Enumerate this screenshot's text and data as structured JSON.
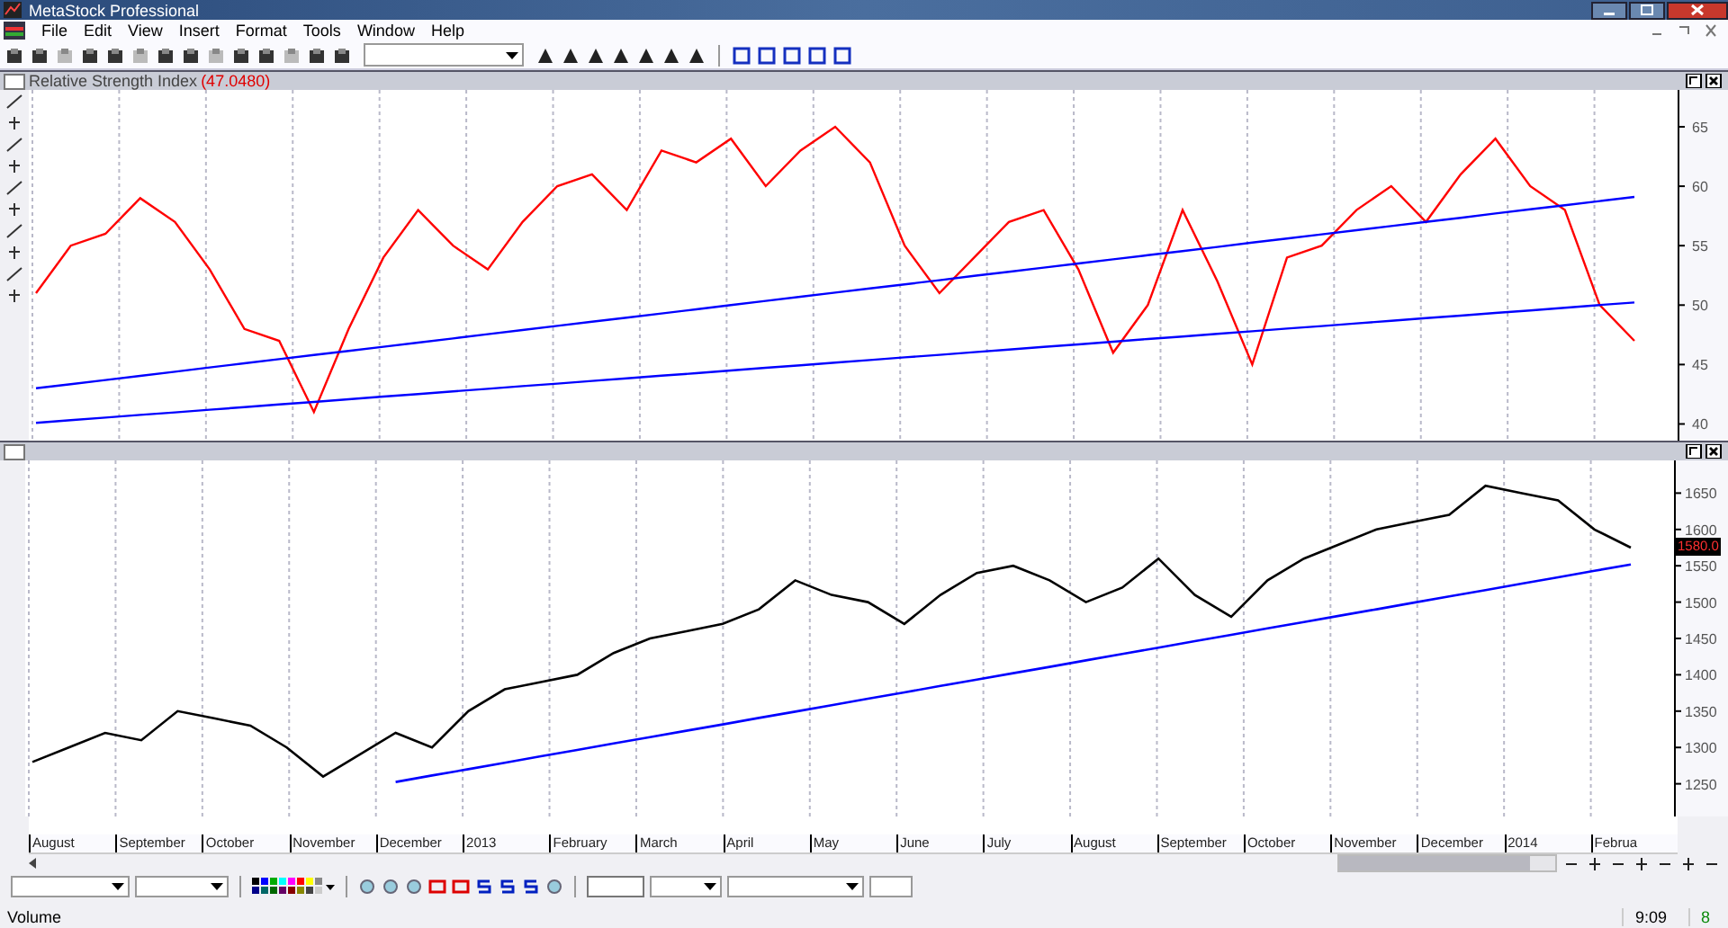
{
  "window": {
    "title": "MetaStock Professional"
  },
  "menu": [
    "File",
    "Edit",
    "View",
    "Insert",
    "Format",
    "Tools",
    "Window",
    "Help"
  ],
  "rsi_panel": {
    "checked": false,
    "value": "(47.0480)",
    "chart_data": {
      "type": "line",
      "grid": true,
      "categories": [
        null,
        null,
        null,
        null,
        null,
        null,
        null,
        null,
        null,
        null,
        null,
        null,
        null,
        null,
        null,
        null,
        null,
        null,
        null,
        null,
        null,
        null,
        null,
        null,
        null,
        null,
        null,
        null,
        null,
        null,
        null,
        null,
        null,
        null,
        null,
        null,
        null,
        null,
        null,
        null,
        null,
        null,
        null,
        null,
        null,
        null,
        null
      ],
      "series": [
        {
          "name": "Relative Strength Index",
          "color": "#ff0000",
          "values": [
            51,
            55,
            56,
            59,
            57,
            53,
            48,
            47,
            41,
            48,
            54,
            58,
            55,
            53,
            57,
            60,
            61,
            58,
            63,
            62,
            64,
            60,
            63,
            65,
            62,
            55,
            51,
            54,
            57,
            58,
            53,
            46,
            50,
            58,
            52,
            45,
            54,
            55,
            58,
            60,
            57,
            61,
            64,
            60,
            58,
            50,
            47
          ]
        },
        {
          "color": "#0000ff",
          "values": [
            43.0,
            43.35,
            43.7,
            44.05,
            44.4,
            44.75,
            45.1,
            45.45,
            45.8,
            46.15,
            46.5,
            46.85,
            47.2,
            47.55,
            47.9,
            48.25,
            48.6,
            48.95,
            49.3,
            49.65,
            50.0,
            50.35,
            50.7,
            51.05,
            51.4,
            51.75,
            52.1,
            52.45,
            52.8,
            53.15,
            53.5,
            53.85,
            54.2,
            54.55,
            54.9,
            55.25,
            55.6,
            55.95,
            56.3,
            56.65,
            57.0,
            57.35,
            57.7,
            58.05,
            58.4,
            58.75,
            59.1
          ]
        },
        {
          "color": "#0000ff",
          "values": [
            40.1,
            40.32,
            40.54,
            40.76,
            40.98,
            41.2,
            41.42,
            41.64,
            41.86,
            42.08,
            42.3,
            42.52,
            42.74,
            42.96,
            43.18,
            43.4,
            43.62,
            43.84,
            44.06,
            44.28,
            44.5,
            44.72,
            44.94,
            45.16,
            45.38,
            45.6,
            45.82,
            46.04,
            46.26,
            46.48,
            46.7,
            46.92,
            47.14,
            47.36,
            47.58,
            47.8,
            48.02,
            48.24,
            48.46,
            48.68,
            48.9,
            49.12,
            49.34,
            49.56,
            49.78,
            50.0,
            50.22
          ]
        }
      ],
      "ylim": [
        38.6,
        68.1
      ],
      "yticks": [
        40,
        45,
        50,
        55,
        60,
        65
      ]
    }
  },
  "price_panel": {
    "checked": false,
    "last_price": "1580.0",
    "chart_data": {
      "type": "line",
      "grid": true,
      "categories": [
        null,
        null,
        null,
        null,
        null,
        null,
        null,
        null,
        null,
        null,
        null,
        null,
        null,
        null,
        null,
        null,
        null,
        null,
        null,
        null,
        null,
        null,
        null,
        null,
        null,
        null,
        null,
        null,
        null,
        null,
        null,
        null,
        null,
        null,
        null,
        null,
        null,
        null,
        null,
        null,
        null,
        null,
        null,
        null,
        null
      ],
      "series": [
        {
          "color": "#000000",
          "values": [
            1280,
            1300,
            1320,
            1310,
            1350,
            1340,
            1330,
            1300,
            1260,
            1290,
            1320,
            1300,
            1350,
            1380,
            1390,
            1400,
            1430,
            1450,
            1460,
            1470,
            1490,
            1530,
            1510,
            1500,
            1470,
            1510,
            1540,
            1550,
            1530,
            1500,
            1520,
            1560,
            1510,
            1480,
            1530,
            1560,
            1580,
            1600,
            1610,
            1620,
            1660,
            1650,
            1640,
            1600,
            1575
          ]
        },
        {
          "color": "#0000ff",
          "values": [
            null,
            null,
            null,
            null,
            null,
            null,
            null,
            null,
            null,
            null,
            1252.6,
            1261.4,
            1270.2,
            1279,
            1287.8,
            1296.6,
            1305.4,
            1314.2,
            1323,
            1331.8,
            1340.6,
            1349.4,
            1358.2,
            1367,
            1375.8,
            1384.6,
            1393.4,
            1402.2,
            1411,
            1419.8,
            1428.6,
            1437.4,
            1446.2,
            1455,
            1463.8,
            1472.6,
            1481.4,
            1490.2,
            1499,
            1507.8,
            1516.6,
            1525.4,
            1534.2,
            1543,
            1551.8
          ]
        }
      ],
      "ylim": [
        1205,
        1695
      ],
      "yticks": [
        1250,
        1300,
        1350,
        1400,
        1450,
        1500,
        1550,
        1600,
        1650
      ]
    }
  },
  "date_axis": [
    "August",
    "September",
    "October",
    "November",
    "December",
    "2013",
    "February",
    "March",
    "April",
    "May",
    "June",
    "July",
    "August",
    "September",
    "October",
    "November",
    "December",
    "2014",
    "Februa"
  ],
  "status_bar": {
    "label": "Volume",
    "time": "9:09",
    "count": "8"
  }
}
